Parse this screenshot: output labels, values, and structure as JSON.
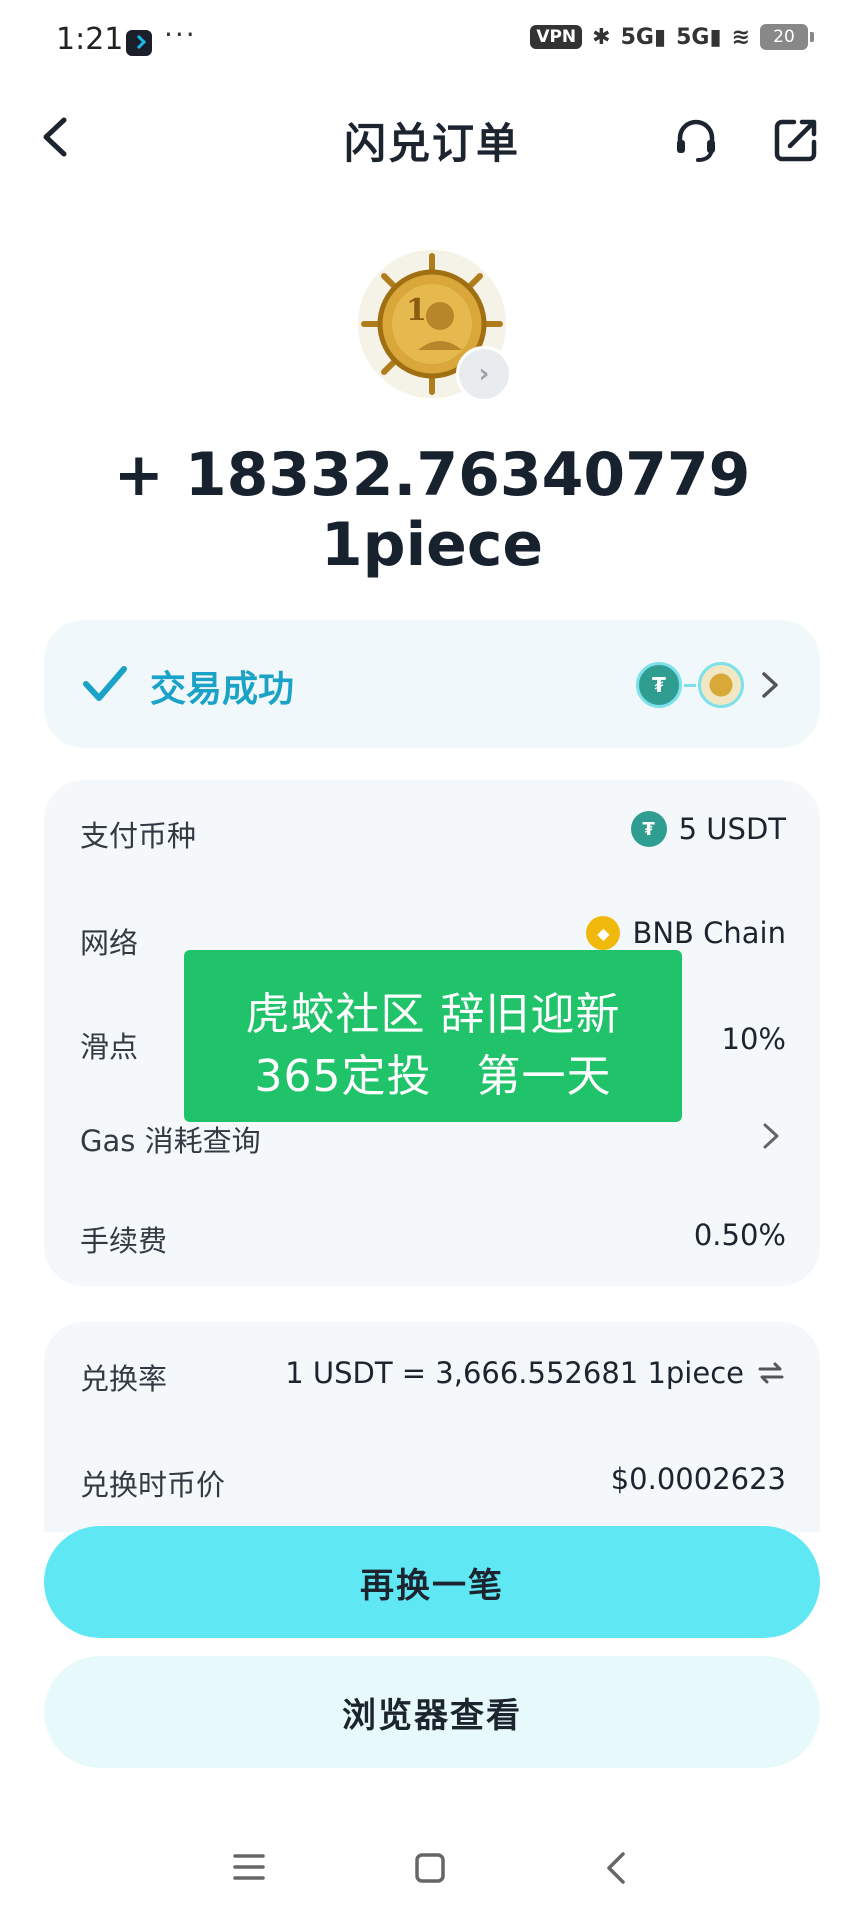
{
  "status_bar": {
    "time": "1:21",
    "dots": "···",
    "vpn": "VPN",
    "signal1": "5G",
    "signal2": "5G",
    "battery": "20"
  },
  "header": {
    "title": "闪兑订单"
  },
  "token": {
    "amount": "+ 18332.76340779 1piece"
  },
  "status_card": {
    "status": "交易成功",
    "usdt_symbol": "₮"
  },
  "details": {
    "rows": [
      {
        "label": "支付币种",
        "value": "5 USDT"
      },
      {
        "label": "网络",
        "value": "BNB Chain"
      },
      {
        "label": "滑点",
        "value": "10%"
      },
      {
        "label": "Gas 消耗查询",
        "value": ""
      },
      {
        "label": "手续费",
        "value": "0.50%"
      }
    ]
  },
  "rates": {
    "rows": [
      {
        "label": "兑换率",
        "value": "1 USDT = 3,666.552681 1piece"
      },
      {
        "label": "兑换时币价",
        "value": "$0.0002623"
      }
    ]
  },
  "overlay": {
    "line1": "虎蛟社区 辞旧迎新",
    "line2": "365定投   第一天"
  },
  "buttons": {
    "swap_again": "再换一笔",
    "view_in_browser": "浏览器查看"
  },
  "colors": {
    "accent": "#1ba2c7",
    "primary_button": "#5fe8f4",
    "secondary_button": "#e7f9fb",
    "overlay": "#20c36a",
    "usdt": "#2f9e91",
    "bnb": "#f0b90b"
  },
  "icons": [
    "back-icon",
    "headset-icon",
    "share-icon",
    "check-icon",
    "chevron-right-icon",
    "swap-icon",
    "menu-icon",
    "home-icon"
  ]
}
